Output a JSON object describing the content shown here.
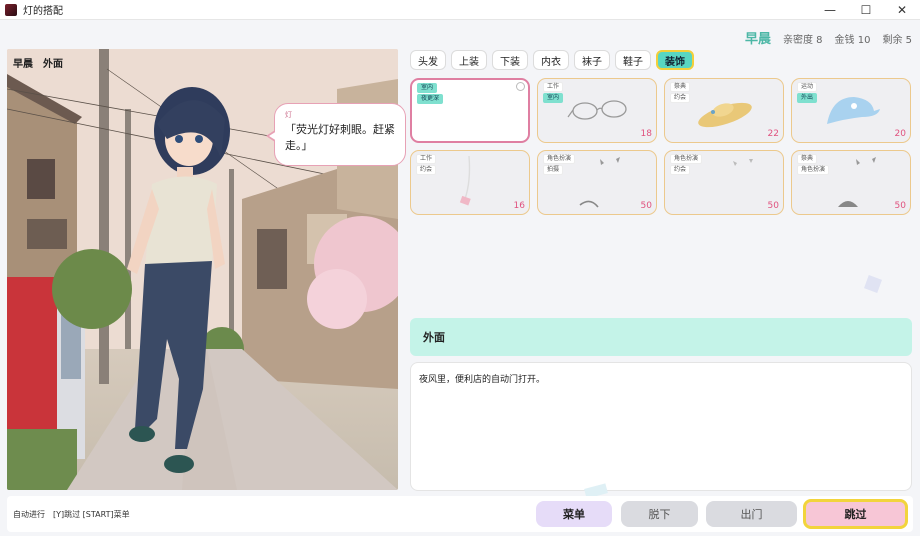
{
  "window": {
    "title": "灯的搭配",
    "minimize": "—",
    "maximize": "☐",
    "close": "✕"
  },
  "status": {
    "time": "早晨",
    "affection": "亲密度 8",
    "money": "金钱 10",
    "remaining": "剩余 5"
  },
  "scene": {
    "time_label": "早晨",
    "location_label": "外面",
    "speech": {
      "speaker": "灯",
      "text": "「荧光灯好刺眼。赶紧走。」"
    }
  },
  "tabs": [
    {
      "label": "头发",
      "active": false
    },
    {
      "label": "上装",
      "active": false
    },
    {
      "label": "下装",
      "active": false
    },
    {
      "label": "内衣",
      "active": false
    },
    {
      "label": "袜子",
      "active": false
    },
    {
      "label": "鞋子",
      "active": false
    },
    {
      "label": "装饰",
      "active": true
    }
  ],
  "items": [
    {
      "tags": [
        "室内",
        "夜更深"
      ],
      "tag_colors": [
        "green",
        "green"
      ],
      "price": "",
      "selected": true,
      "icon": "empty-item-icon"
    },
    {
      "tags": [
        "工作",
        "室内"
      ],
      "tag_colors": [
        "",
        "green"
      ],
      "price": "18",
      "selected": false,
      "icon": "glasses-icon"
    },
    {
      "tags": [
        "祭典",
        "约会"
      ],
      "tag_colors": [
        "",
        ""
      ],
      "price": "22",
      "selected": false,
      "icon": "straw-hat-icon"
    },
    {
      "tags": [
        "运动",
        "外出"
      ],
      "tag_colors": [
        "",
        "green"
      ],
      "price": "20",
      "selected": false,
      "icon": "cap-icon"
    },
    {
      "tags": [
        "工作",
        "约会"
      ],
      "tag_colors": [
        "",
        ""
      ],
      "price": "16",
      "selected": false,
      "icon": "necklace-icon"
    },
    {
      "tags": [
        "角色扮演",
        "拍摄"
      ],
      "tag_colors": [
        "",
        ""
      ],
      "price": "50",
      "selected": false,
      "icon": "cosplay-accessory-icon"
    },
    {
      "tags": [
        "角色扮演",
        "约会"
      ],
      "tag_colors": [
        "",
        ""
      ],
      "price": "50",
      "selected": false,
      "icon": "cosplay-accessory-icon"
    },
    {
      "tags": [
        "祭典",
        "角色扮演"
      ],
      "tag_colors": [
        "",
        ""
      ],
      "price": "50",
      "selected": false,
      "icon": "cosplay-accessory-icon"
    }
  ],
  "location": {
    "name": "外面",
    "description": "夜风里，便利店的自动门打开。"
  },
  "bottom": {
    "hint_auto": "自动进行",
    "hint_keys": "[Y]跳过 [START]菜单",
    "menu": "菜单",
    "undress": "脱下",
    "go_out": "出门",
    "skip": "跳过"
  },
  "colors": {
    "accent": "#58d6c2",
    "highlight": "#f2cf3b",
    "price": "#e0527f",
    "pink": "#f7c6d6"
  }
}
